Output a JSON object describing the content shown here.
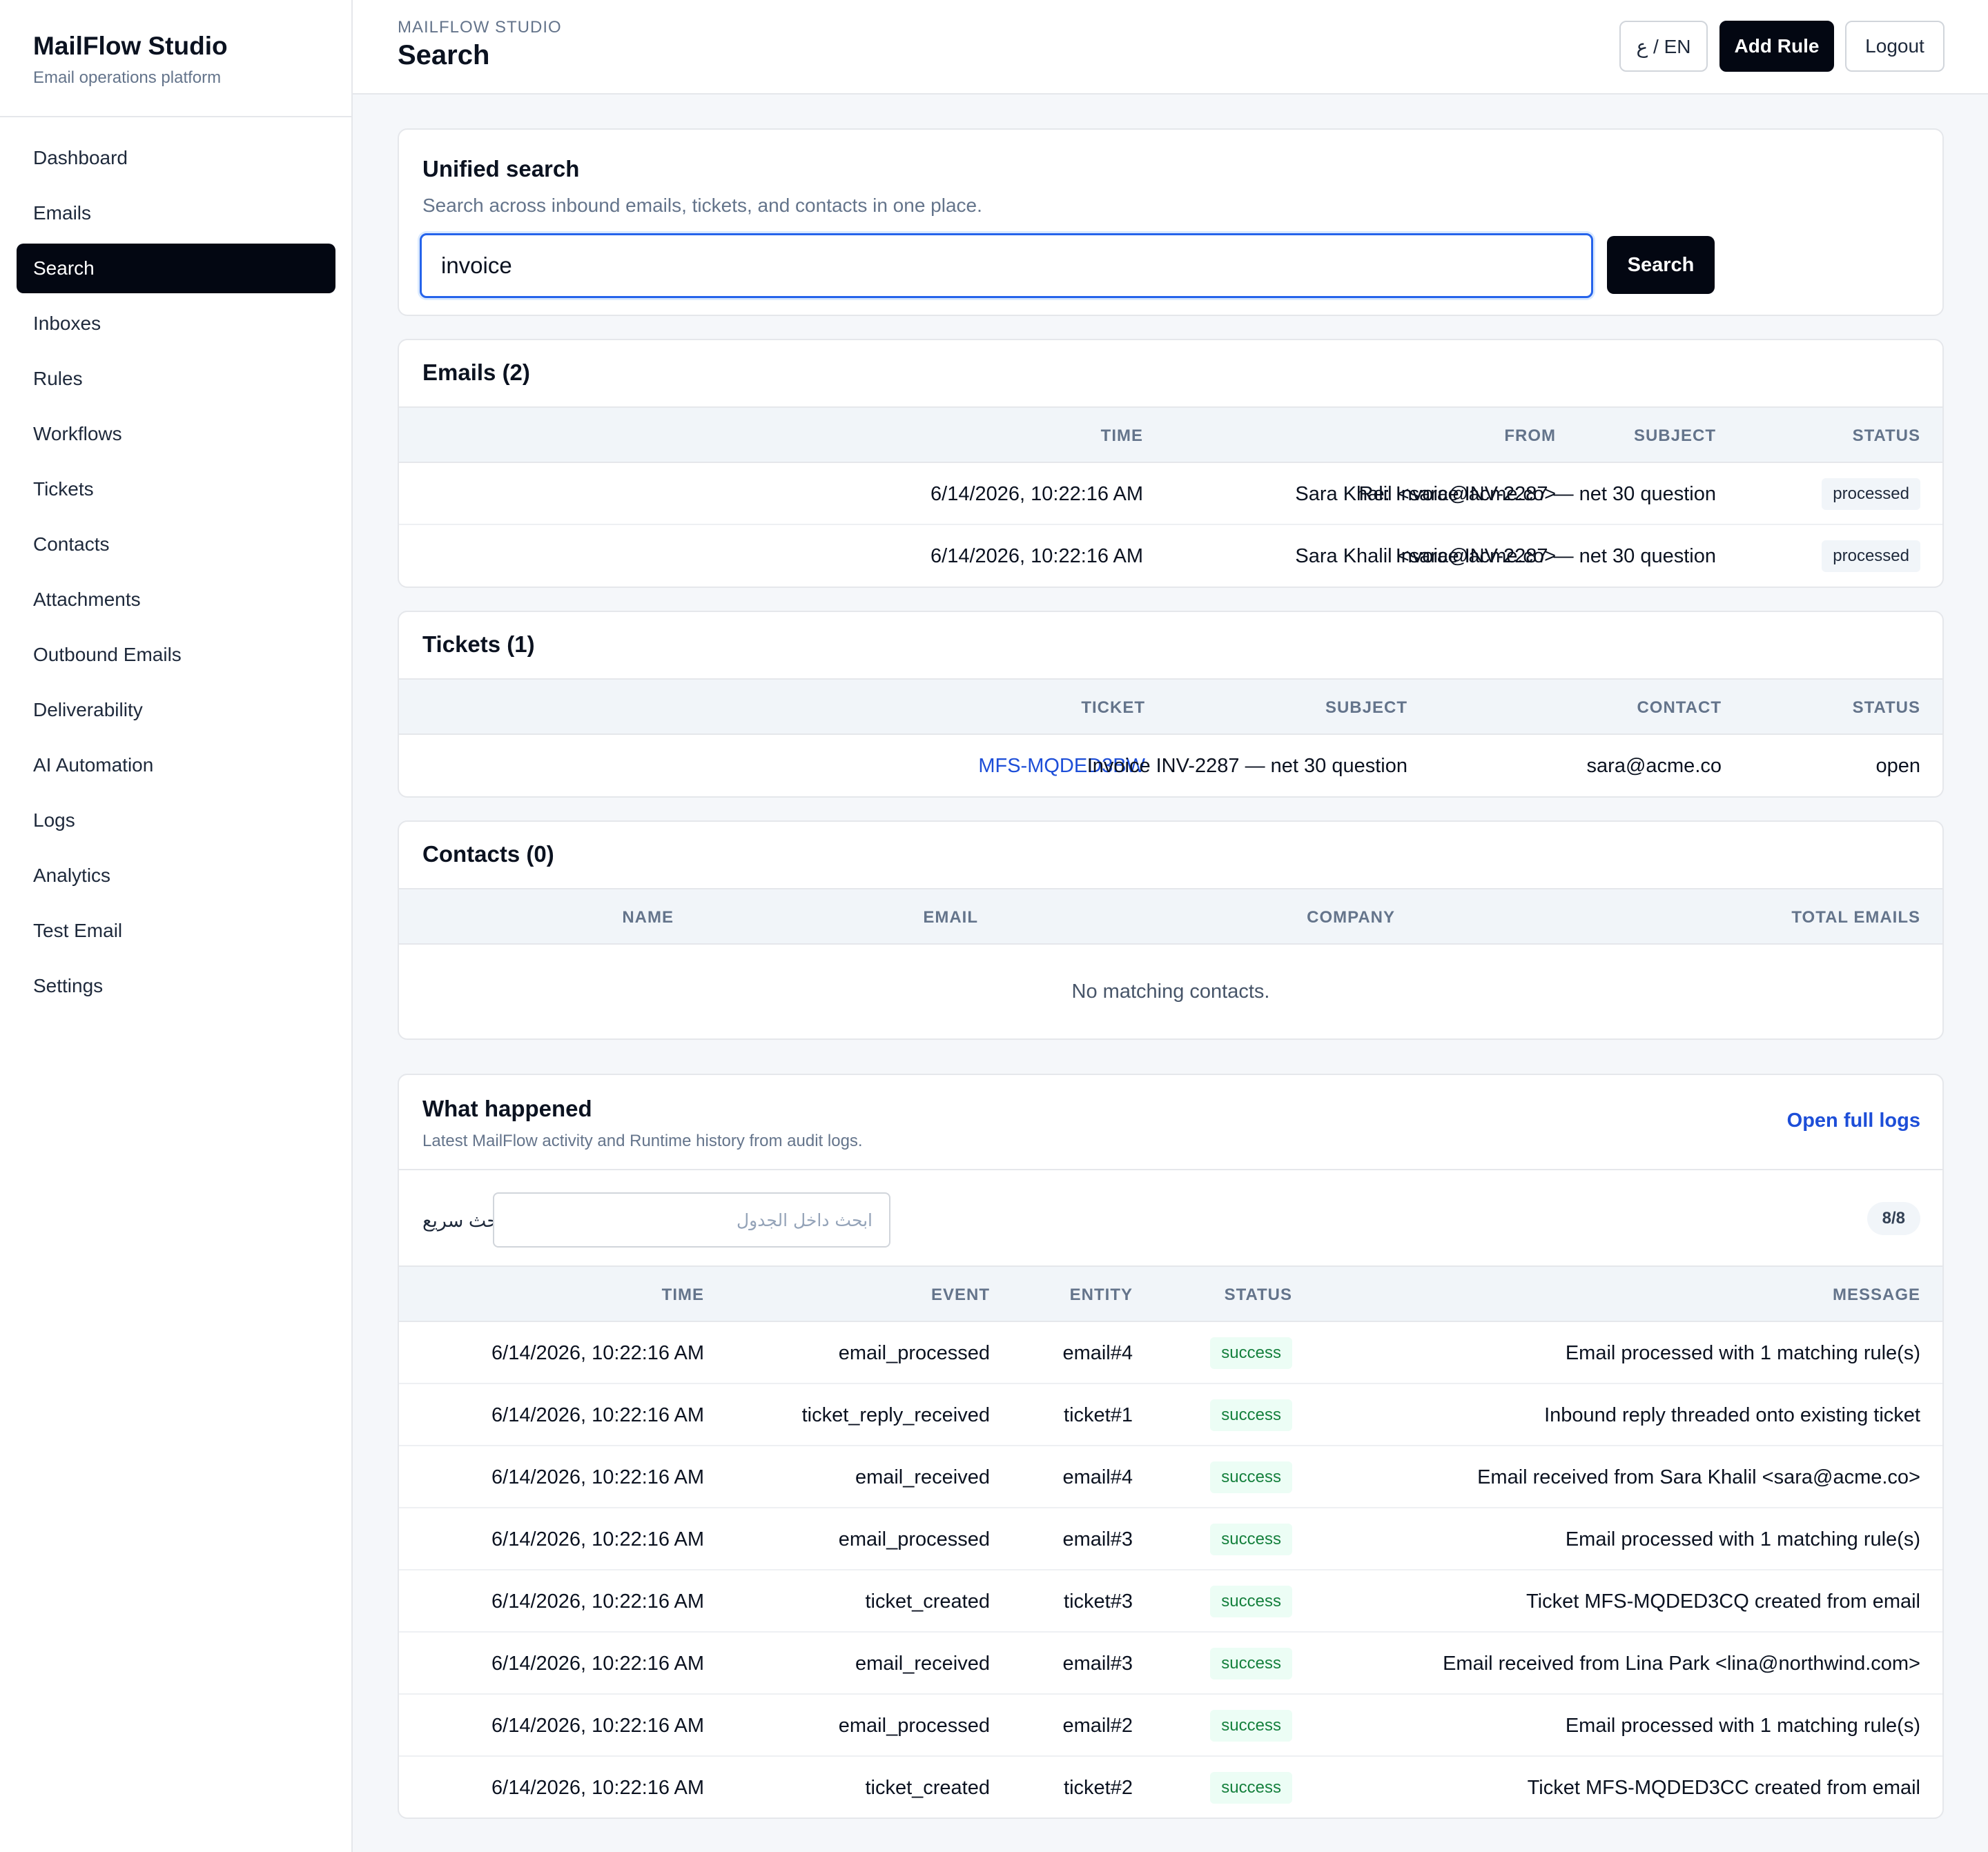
{
  "app": {
    "brand_title": "MailFlow Studio",
    "brand_subtitle": "Email operations platform"
  },
  "sidebar": {
    "items": [
      {
        "label": "Dashboard",
        "active": false
      },
      {
        "label": "Emails",
        "active": false
      },
      {
        "label": "Search",
        "active": true
      },
      {
        "label": "Inboxes",
        "active": false
      },
      {
        "label": "Rules",
        "active": false
      },
      {
        "label": "Workflows",
        "active": false
      },
      {
        "label": "Tickets",
        "active": false
      },
      {
        "label": "Contacts",
        "active": false
      },
      {
        "label": "Attachments",
        "active": false
      },
      {
        "label": "Outbound Emails",
        "active": false
      },
      {
        "label": "Deliverability",
        "active": false
      },
      {
        "label": "AI Automation",
        "active": false
      },
      {
        "label": "Logs",
        "active": false
      },
      {
        "label": "Analytics",
        "active": false
      },
      {
        "label": "Test Email",
        "active": false
      },
      {
        "label": "Settings",
        "active": false
      }
    ]
  },
  "header": {
    "eyebrow": "MAILFLOW STUDIO",
    "title": "Search",
    "lang_toggle": "ع / EN",
    "add_rule": "Add Rule",
    "logout": "Logout"
  },
  "search": {
    "title": "Unified search",
    "subtitle": "Search across inbound emails, tickets, and contacts in one place.",
    "query": "invoice",
    "button": "Search"
  },
  "emails": {
    "title": "Emails (2)",
    "columns": {
      "time": "TIME",
      "from": "FROM",
      "subject": "SUBJECT",
      "status": "STATUS"
    },
    "rows": [
      {
        "time": "6/14/2026, 10:22:16 AM",
        "from": "Sara Khalil <sara@acme.co>",
        "subject": "Re: Invoice INV-2287 — net 30 question",
        "status": "processed"
      },
      {
        "time": "6/14/2026, 10:22:16 AM",
        "from": "Sara Khalil <sara@acme.co>",
        "subject": "Invoice INV-2287 — net 30 question",
        "status": "processed"
      }
    ]
  },
  "tickets": {
    "title": "Tickets (1)",
    "columns": {
      "ticket": "TICKET",
      "subject": "SUBJECT",
      "contact": "CONTACT",
      "status": "STATUS"
    },
    "rows": [
      {
        "ticket": "MFS-MQDED3BW",
        "subject": "Invoice INV-2287 — net 30 question",
        "contact": "sara@acme.co",
        "status": "open"
      }
    ]
  },
  "contacts": {
    "title": "Contacts (0)",
    "columns": {
      "name": "NAME",
      "email": "EMAIL",
      "company": "COMPANY",
      "total": "TOTAL EMAILS"
    },
    "empty": "No matching contacts."
  },
  "activity": {
    "title": "What happened",
    "subtitle": "Latest MailFlow activity and Runtime history from audit logs.",
    "open_logs": "Open full logs",
    "quick_search_label": "بحث سريع",
    "quick_search_placeholder": "ابحث داخل الجدول",
    "count": "8/8",
    "columns": {
      "time": "TIME",
      "event": "EVENT",
      "entity": "ENTITY",
      "status": "STATUS",
      "message": "MESSAGE"
    },
    "rows": [
      {
        "time": "6/14/2026, 10:22:16 AM",
        "event": "email_processed",
        "entity": "email#4",
        "status": "success",
        "message": "Email processed with 1 matching rule(s)"
      },
      {
        "time": "6/14/2026, 10:22:16 AM",
        "event": "ticket_reply_received",
        "entity": "ticket#1",
        "status": "success",
        "message": "Inbound reply threaded onto existing ticket"
      },
      {
        "time": "6/14/2026, 10:22:16 AM",
        "event": "email_received",
        "entity": "email#4",
        "status": "success",
        "message": "Email received from Sara Khalil <sara@acme.co>"
      },
      {
        "time": "6/14/2026, 10:22:16 AM",
        "event": "email_processed",
        "entity": "email#3",
        "status": "success",
        "message": "Email processed with 1 matching rule(s)"
      },
      {
        "time": "6/14/2026, 10:22:16 AM",
        "event": "ticket_created",
        "entity": "ticket#3",
        "status": "success",
        "message": "Ticket MFS-MQDED3CQ created from email"
      },
      {
        "time": "6/14/2026, 10:22:16 AM",
        "event": "email_received",
        "entity": "email#3",
        "status": "success",
        "message": "Email received from Lina Park <lina@northwind.com>"
      },
      {
        "time": "6/14/2026, 10:22:16 AM",
        "event": "email_processed",
        "entity": "email#2",
        "status": "success",
        "message": "Email processed with 1 matching rule(s)"
      },
      {
        "time": "6/14/2026, 10:22:16 AM",
        "event": "ticket_created",
        "entity": "ticket#2",
        "status": "success",
        "message": "Ticket MFS-MQDED3CC created from email"
      }
    ]
  }
}
